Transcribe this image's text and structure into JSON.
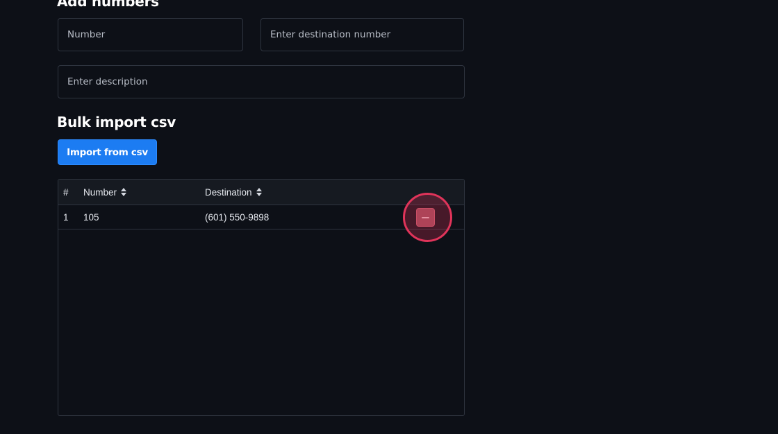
{
  "add_numbers": {
    "title": "Add numbers",
    "number_placeholder": "Number",
    "destination_placeholder": "Enter destination number",
    "description_placeholder": "Enter description"
  },
  "bulk_import": {
    "title": "Bulk import csv",
    "import_button_label": "Import from csv"
  },
  "table": {
    "headers": {
      "index": "#",
      "number": "Number",
      "destination": "Destination"
    },
    "rows": [
      {
        "index": "1",
        "number": "105",
        "destination": "(601) 550-9898"
      }
    ]
  },
  "icons": {
    "sort": "sort-icon",
    "remove": "minus-icon"
  },
  "colors": {
    "background": "#0d1017",
    "primary": "#1c7cf2",
    "danger": "#9c4a58",
    "highlight": "#e0345a"
  }
}
